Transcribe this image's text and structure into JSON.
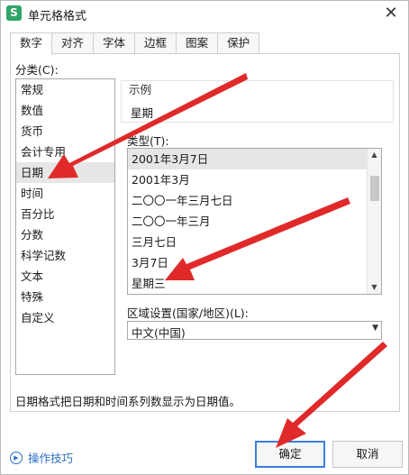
{
  "window": {
    "title": "单元格格式",
    "app_icon_glyph": "S",
    "close_glyph": "✕"
  },
  "tabs": [
    {
      "label": "数字",
      "active": true
    },
    {
      "label": "对齐"
    },
    {
      "label": "字体"
    },
    {
      "label": "边框"
    },
    {
      "label": "图案"
    },
    {
      "label": "保护"
    }
  ],
  "category": {
    "label": "分类(C):",
    "items": [
      "常规",
      "数值",
      "货币",
      "会计专用",
      "日期",
      "时间",
      "百分比",
      "分数",
      "科学记数",
      "文本",
      "特殊",
      "自定义"
    ],
    "selected": "日期"
  },
  "sample": {
    "label": "示例",
    "value": "星期"
  },
  "type": {
    "label": "类型(T):",
    "items": [
      "2001年3月7日",
      "2001年3月",
      "二〇〇一年三月七日",
      "二〇〇一年三月",
      "三月七日",
      "3月7日",
      "星期三"
    ],
    "selected": "2001年3月7日"
  },
  "region": {
    "label": "区域设置(国家/地区)(L):",
    "value": "中文(中国)"
  },
  "description": "日期格式把日期和时间系列数显示为日期值。",
  "footer": {
    "help_label": "操作技巧",
    "ok_label": "确定",
    "cancel_label": "取消"
  },
  "colors": {
    "accent": "#3b7ddd",
    "annotation_arrow": "#e02a2a",
    "app_icon": "#2fa56a"
  }
}
